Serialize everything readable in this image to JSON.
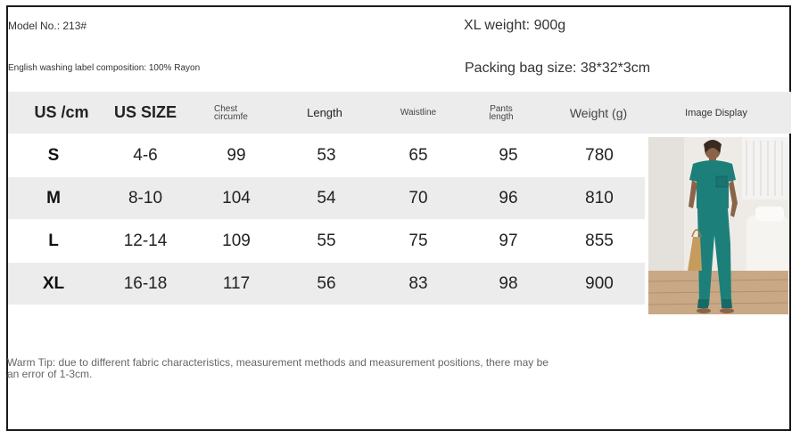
{
  "model_no": "Model No.: 213#",
  "composition": "English washing label composition: 100% Rayon",
  "xl_weight": "XL weight: 900g",
  "packing_size": "Packing bag size: 38*32*3cm",
  "headers": {
    "us_cm": "US /cm",
    "us_size": "US SIZE",
    "chest": "Chest circumfe",
    "length": "Length",
    "waistline": "Waistline",
    "pants": "Pants length",
    "weight": "Weight (g)",
    "image": "Image Display"
  },
  "rows": [
    {
      "size": "S",
      "us_size": "4-6",
      "chest": "99",
      "length": "53",
      "waist": "65",
      "pants": "95",
      "weight": "780"
    },
    {
      "size": "M",
      "us_size": "8-10",
      "chest": "104",
      "length": "54",
      "waist": "70",
      "pants": "96",
      "weight": "810"
    },
    {
      "size": "L",
      "us_size": "12-14",
      "chest": "109",
      "length": "55",
      "waist": "75",
      "pants": "97",
      "weight": "855"
    },
    {
      "size": "XL",
      "us_size": "16-18",
      "chest": "117",
      "length": "56",
      "waist": "83",
      "pants": "98",
      "weight": "900"
    }
  ],
  "warm_tip": "Warm Tip: due to different fabric characteristics, measurement methods and measurement positions, there may be an error of 1-3cm.",
  "colors": {
    "row_alt": "#ececec",
    "outfit": "#1d7f7a"
  }
}
